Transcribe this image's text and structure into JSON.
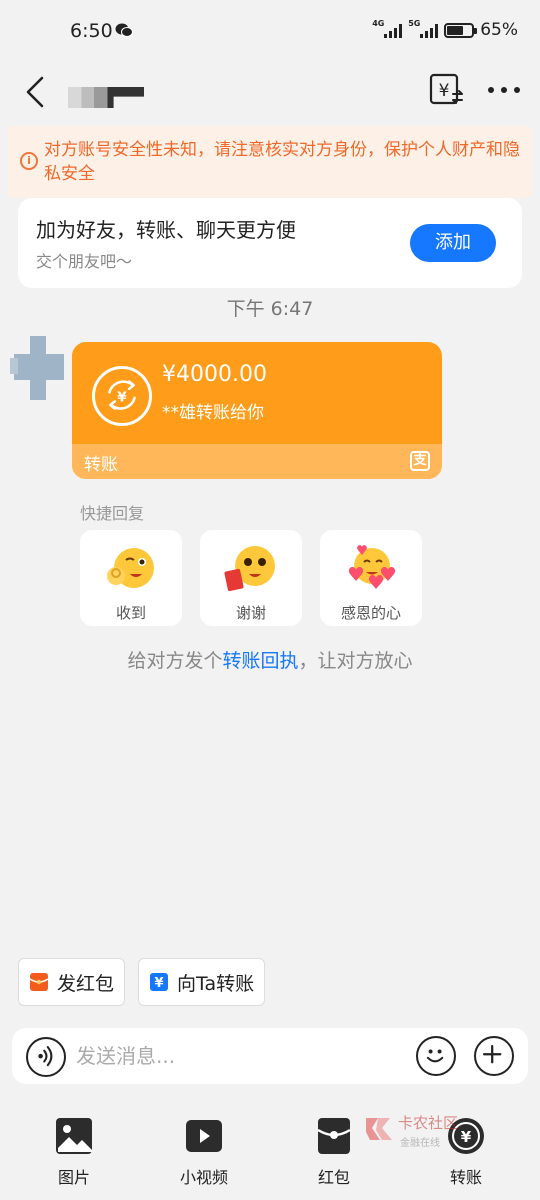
{
  "status_bar": {
    "time": "6:50",
    "battery": "65%",
    "battery_level": 0.65,
    "network1": "4G",
    "network2": "5G"
  },
  "nav": {
    "icons": [
      "back-icon",
      "transfer-record-icon",
      "more-icon"
    ]
  },
  "warning": {
    "text": "对方账号安全性未知，请注意核实对方身份，保护个人财产和隐私安全",
    "icon": "i"
  },
  "add_friend": {
    "title": "加为好友，转账、聊天更方便",
    "subtitle": "交个朋友吧～",
    "button": "添加"
  },
  "message": {
    "time": "下午 6:47",
    "transfer": {
      "amount": "¥4000.00",
      "description": "**雄转账给你",
      "footer_label": "转账",
      "color": "#ff9c1a"
    }
  },
  "quick_reply": {
    "label": "快捷回复",
    "items": [
      {
        "label": "收到"
      },
      {
        "label": "谢谢"
      },
      {
        "label": "感恩的心"
      }
    ]
  },
  "receipt_tip": {
    "prefix": "给对方发个",
    "link": "转账回执",
    "suffix": "，让对方放心"
  },
  "actions": {
    "red_packet": "发红包",
    "transfer": "向Ta转账"
  },
  "input": {
    "placeholder": "发送消息..."
  },
  "toolbar": [
    {
      "label": "图片"
    },
    {
      "label": "小视频"
    },
    {
      "label": "红包"
    },
    {
      "label": "转账"
    }
  ],
  "watermark": {
    "main": "卡农社区",
    "sub": "金融在线"
  },
  "colors": {
    "accent_blue": "#1677ff",
    "warning_orange": "#f0692a",
    "transfer_orange": "#ff9c1a"
  }
}
